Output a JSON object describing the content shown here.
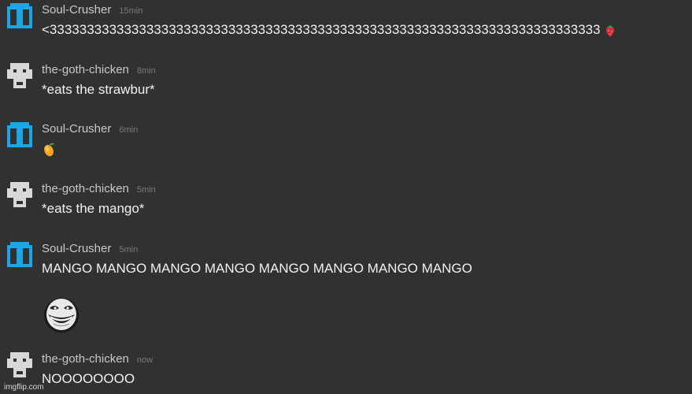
{
  "messages": [
    {
      "user": "Soul-Crusher",
      "time": "15min",
      "text": "<33333333333333333333333333333333333333333333333333333333333333333333333333",
      "emoji": "strawberry"
    },
    {
      "user": "the-goth-chicken",
      "time": "8min",
      "text": "*eats the strawbur*"
    },
    {
      "user": "Soul-Crusher",
      "time": "6min",
      "text": "",
      "emoji": "mango"
    },
    {
      "user": "the-goth-chicken",
      "time": "5min",
      "text": "*eats the mango*"
    },
    {
      "user": "Soul-Crusher",
      "time": "5min",
      "text": "MANGO MANGO MANGO MANGO MANGO MANGO MANGO MANGO",
      "image": "trollface-emoji"
    },
    {
      "user": "the-goth-chicken",
      "time": "now",
      "text": "NOOOOOOOO"
    }
  ],
  "watermark": "imgflip.com",
  "colors": {
    "background": "#313131",
    "username": "#c9c9c9",
    "timestamp": "#7b7b7b",
    "message": "#f1f1f1",
    "soul_avatar": "#1aa6e8",
    "goth_avatar": "#d8d8d8"
  }
}
